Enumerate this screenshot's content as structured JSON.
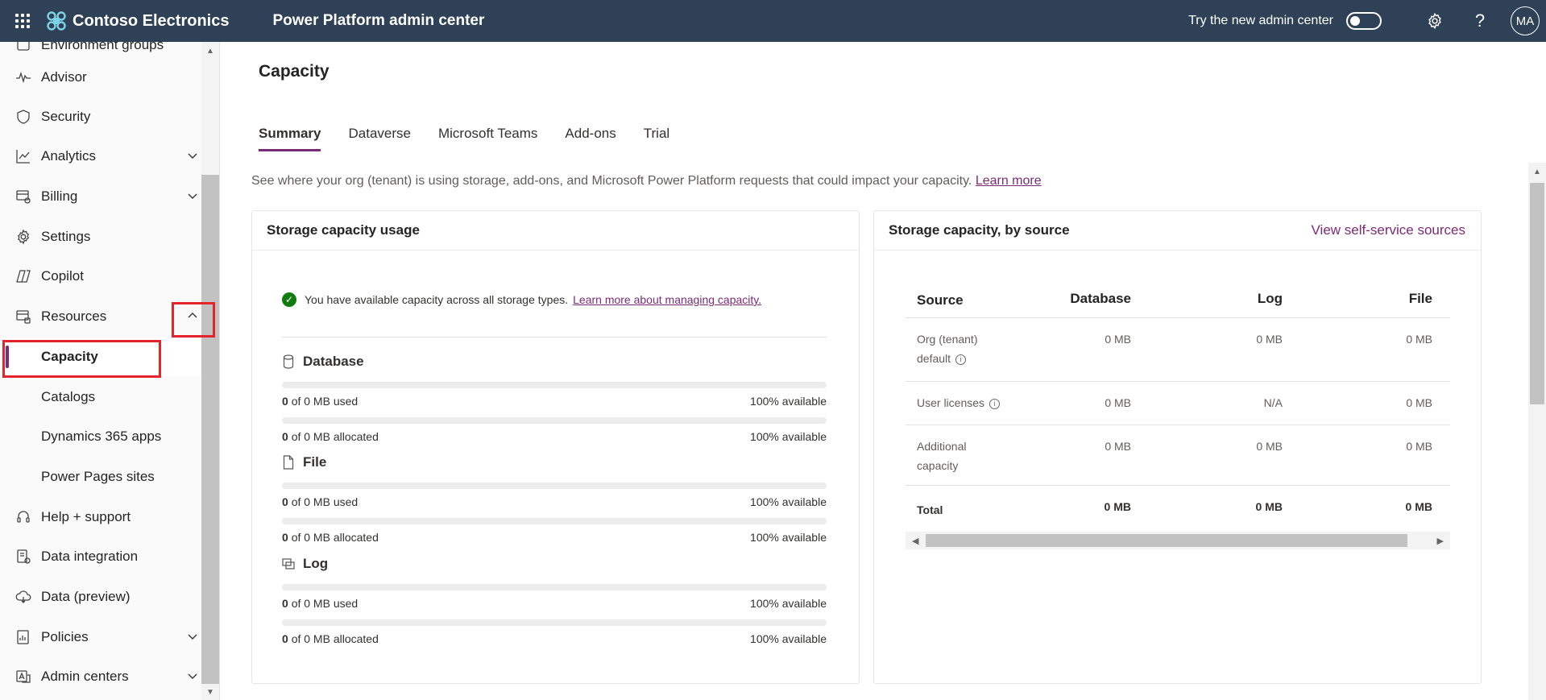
{
  "header": {
    "brand": "Contoso Electronics",
    "product": "Power Platform admin center",
    "try_new_label": "Try the new admin center",
    "try_new_on": false,
    "avatar_initials": "MA",
    "color": "#2f4156"
  },
  "sidebar": {
    "partial_item": "Environment groups",
    "items": [
      {
        "label": "Advisor",
        "icon": "pulse-icon"
      },
      {
        "label": "Security",
        "icon": "shield-icon"
      },
      {
        "label": "Analytics",
        "icon": "chart-line-icon",
        "expandable": true
      },
      {
        "label": "Billing",
        "icon": "billing-icon",
        "expandable": true
      },
      {
        "label": "Settings",
        "icon": "gear-icon"
      },
      {
        "label": "Copilot",
        "icon": "copilot-icon"
      },
      {
        "label": "Resources",
        "icon": "resources-icon",
        "expanded": true
      },
      {
        "label": "Capacity",
        "active": true
      },
      {
        "label": "Catalogs"
      },
      {
        "label": "Dynamics 365 apps"
      },
      {
        "label": "Power Pages sites"
      },
      {
        "label": "Help + support",
        "icon": "headset-icon"
      },
      {
        "label": "Data integration",
        "icon": "data-integration-icon"
      },
      {
        "label": "Data (preview)",
        "icon": "cloud-data-icon"
      },
      {
        "label": "Policies",
        "icon": "policies-icon",
        "expandable": true
      },
      {
        "label": "Admin centers",
        "icon": "admin-centers-icon",
        "expandable": true
      }
    ]
  },
  "main": {
    "title": "Capacity",
    "tabs": [
      "Summary",
      "Dataverse",
      "Microsoft Teams",
      "Add-ons",
      "Trial"
    ],
    "active_tab": "Summary",
    "intro": "See where your org (tenant) is using storage, add-ons, and Microsoft Power Platform requests that could impact your capacity.",
    "intro_link": "Learn more",
    "accent": "#7a2b77"
  },
  "usage_card": {
    "title": "Storage capacity usage",
    "notice": "You have available capacity across all storage types.",
    "notice_link": "Learn more about managing capacity.",
    "sections": [
      {
        "title": "Database",
        "rows": [
          {
            "value": "0",
            "text": "of 0 MB used",
            "available": "100% available",
            "fill": 0
          },
          {
            "value": "0",
            "text": "of 0 MB allocated",
            "available": "100% available",
            "fill": 0
          }
        ]
      },
      {
        "title": "File",
        "rows": [
          {
            "value": "0",
            "text": "of 0 MB used",
            "available": "100% available",
            "fill": 0
          },
          {
            "value": "0",
            "text": "of 0 MB allocated",
            "available": "100% available",
            "fill": 0
          }
        ]
      },
      {
        "title": "Log",
        "rows": [
          {
            "value": "0",
            "text": "of 0 MB used",
            "available": "100% available",
            "fill": 0
          },
          {
            "value": "0",
            "text": "of 0 MB allocated",
            "available": "100% available",
            "fill": 0
          }
        ]
      }
    ]
  },
  "source_card": {
    "title": "Storage capacity, by source",
    "link": "View self-service sources",
    "columns": [
      "Source",
      "Database",
      "Log",
      "File"
    ],
    "rows": [
      {
        "source": "Org (tenant) default",
        "info": true,
        "database": "0 MB",
        "log": "0 MB",
        "file": "0 MB"
      },
      {
        "source": "User licenses",
        "info": true,
        "database": "0 MB",
        "log": "N/A",
        "file": "0 MB"
      },
      {
        "source": "Additional capacity",
        "info": false,
        "database": "0 MB",
        "log": "0 MB",
        "file": "0 MB"
      },
      {
        "source": "Total",
        "info": false,
        "database": "0 MB",
        "log": "0 MB",
        "file": "0 MB",
        "bold": true
      }
    ]
  }
}
